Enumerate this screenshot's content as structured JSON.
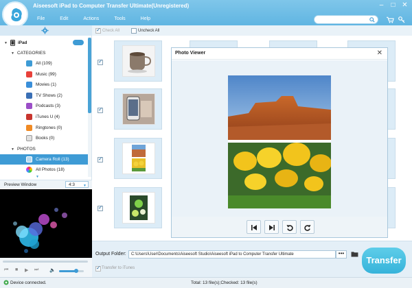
{
  "app": {
    "title": "Aiseesoft iPad to Computer Transfer Ultimate(Unregistered)",
    "menu": [
      "File",
      "Edit",
      "Actions",
      "Tools",
      "Help"
    ],
    "window_controls": [
      "–",
      "□",
      "✕"
    ]
  },
  "search": {
    "value": "",
    "placeholder": ""
  },
  "sidebar": {
    "device": "iPad",
    "categories_label": "CATEGORIES",
    "categories": [
      {
        "label": "All (109)",
        "icon": "all-icon",
        "color": "#3e9bd5"
      },
      {
        "label": "Music (99)",
        "icon": "music-icon",
        "color": "#e8413a"
      },
      {
        "label": "Movies (1)",
        "icon": "movies-icon",
        "color": "#3a8fd9"
      },
      {
        "label": "TV Shows (2)",
        "icon": "tv-shows-icon",
        "color": "#3a6fb5"
      },
      {
        "label": "Podcasts (3)",
        "icon": "podcasts-icon",
        "color": "#9b4ec7"
      },
      {
        "label": "iTunes U (4)",
        "icon": "itunes-u-icon",
        "color": "#c8352e"
      },
      {
        "label": "Ringtones (0)",
        "icon": "ringtones-icon",
        "color": "#f08a24"
      },
      {
        "label": "Books (0)",
        "icon": "books-icon",
        "color": "#e0e0e0"
      }
    ],
    "photos_label": "PHOTOS",
    "photos": [
      {
        "label": "Camera Roll (13)",
        "icon": "camera-roll-icon",
        "selected": true
      },
      {
        "label": "All Photos (18)",
        "icon": "all-photos-icon",
        "selected": false
      }
    ]
  },
  "preview": {
    "title": "Preview Window",
    "ratio": "4:3",
    "progress": 0,
    "volume": 0.7
  },
  "toolbar": {
    "check_all": "Check All",
    "uncheck_all": "Uncheck All"
  },
  "photo_viewer": {
    "title": "Photo Viewer",
    "close": "✕",
    "buttons": [
      "previous",
      "next",
      "rotate-left",
      "rotate-right"
    ]
  },
  "bottom": {
    "output_label": "Output Folder:",
    "output_path": "C:\\Users\\User\\Documents\\Aiseesoft Studio\\Aiseesoft iPad to Computer Transfer Ultimate",
    "browse": "•••",
    "transfer_to_itunes": "Transfer to iTunes",
    "transfer": "Transfer"
  },
  "status": {
    "text": "Device connected.",
    "file_count": "Total: 13 file(s);Checked: 13 file(s)"
  },
  "colors": {
    "accent": "#3e9bd5",
    "title_bar": "#6abde6",
    "transfer": "#45c0e2"
  }
}
